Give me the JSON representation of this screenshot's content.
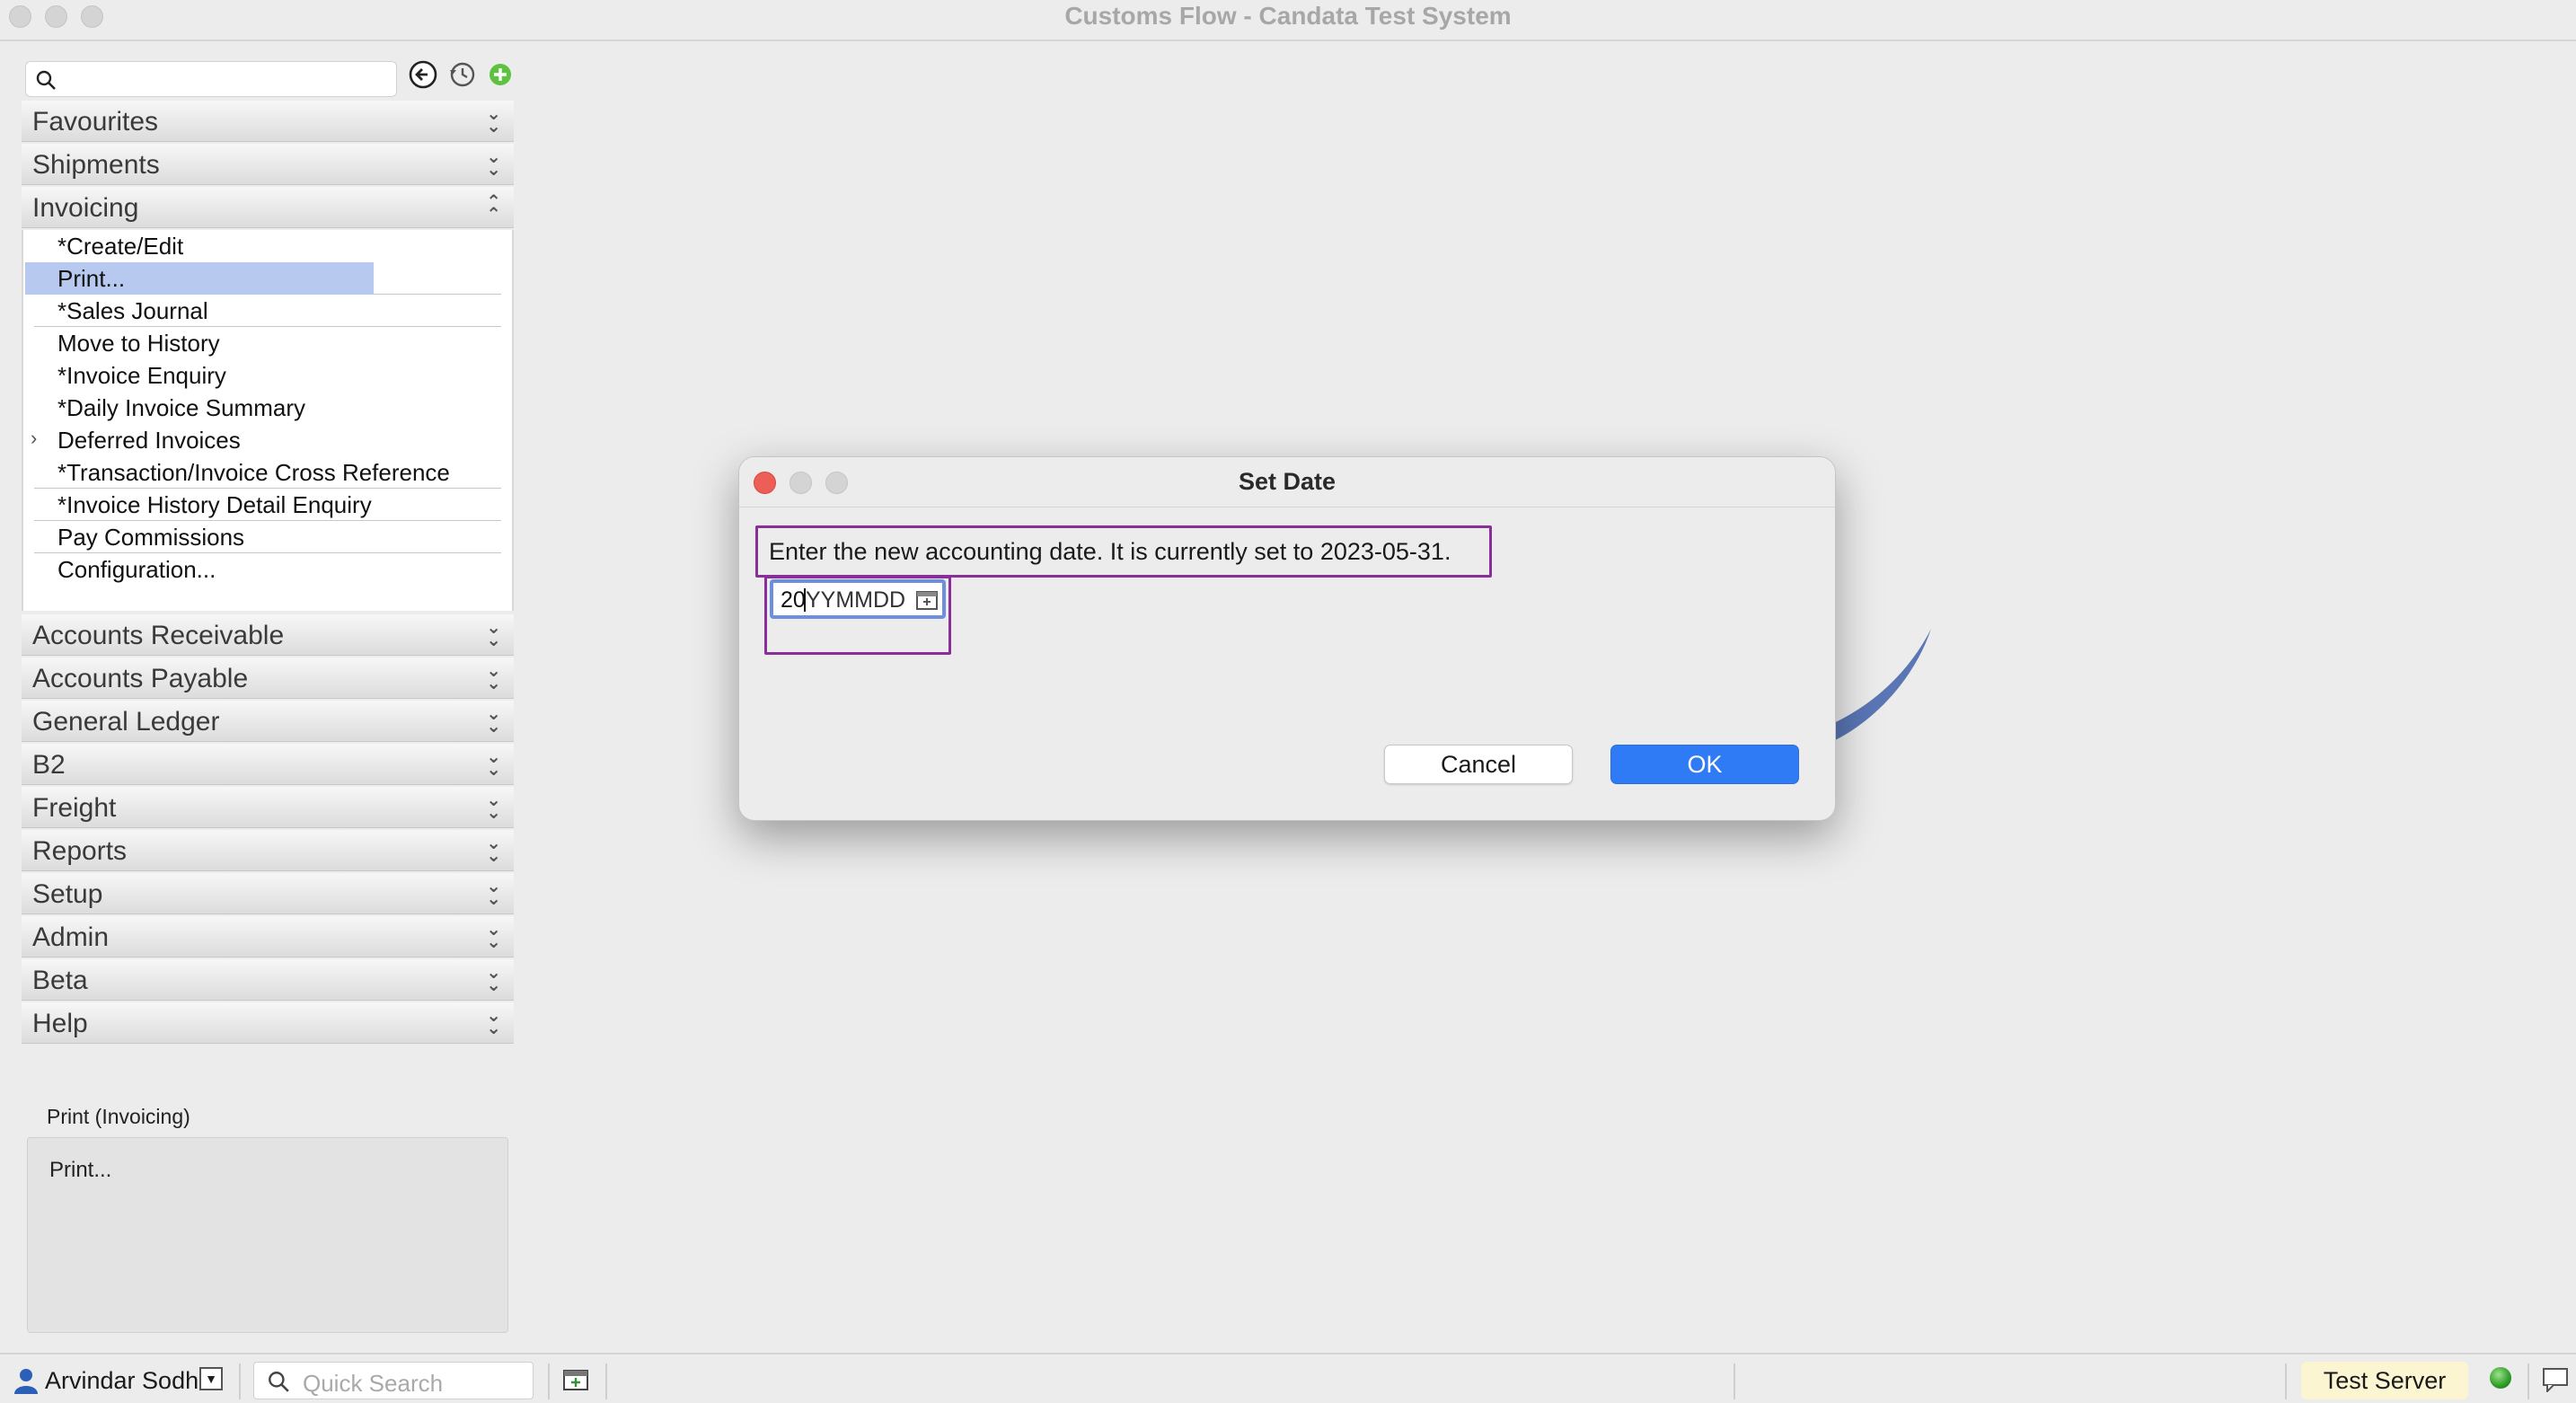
{
  "window": {
    "title": "Customs Flow - Candata Test System"
  },
  "sidebar": {
    "search_placeholder": "",
    "sections_top": [
      {
        "label": "Favourites",
        "chevron": "»"
      },
      {
        "label": "Shipments",
        "chevron": "»"
      },
      {
        "label": "Invoicing",
        "chevron": "«"
      }
    ],
    "invoicing_items": [
      {
        "label": "*Create/Edit"
      },
      {
        "label": "Print..."
      },
      {
        "label": "*Sales Journal"
      },
      {
        "label": "Move to History"
      },
      {
        "label": "*Invoice Enquiry"
      },
      {
        "label": "*Daily Invoice Summary"
      },
      {
        "label": "Deferred Invoices",
        "expand_arrow": "›"
      },
      {
        "label": "*Transaction/Invoice Cross Reference"
      },
      {
        "label": "*Invoice History Detail Enquiry"
      },
      {
        "label": "Pay Commissions"
      },
      {
        "label": "Configuration..."
      }
    ],
    "sections_bottom": [
      {
        "label": "Accounts Receivable",
        "chevron": "»"
      },
      {
        "label": "Accounts Payable",
        "chevron": "»"
      },
      {
        "label": "General Ledger",
        "chevron": "»"
      },
      {
        "label": "B2",
        "chevron": "»"
      },
      {
        "label": "Freight",
        "chevron": "»"
      },
      {
        "label": "Reports",
        "chevron": "»"
      },
      {
        "label": "Setup",
        "chevron": "»"
      },
      {
        "label": "Admin",
        "chevron": "»"
      },
      {
        "label": "Beta",
        "chevron": "»"
      },
      {
        "label": "Help",
        "chevron": "»"
      }
    ],
    "info": {
      "title": "Print (Invoicing)",
      "body": "Print..."
    }
  },
  "dialog": {
    "title": "Set Date",
    "message": "Enter the new accounting date. It is currently set to 2023-05-31.",
    "date_value": "20",
    "date_placeholder": "YYMMDD",
    "cancel_label": "Cancel",
    "ok_label": "OK"
  },
  "statusbar": {
    "user": "Arvindar Sodhi",
    "user_dropdown": "▼",
    "quick_search_placeholder": "Quick Search",
    "server": "Test Server"
  },
  "colors": {
    "accent": "#2f7bf5",
    "selection": "#b7c9ee",
    "highlight_box": "#8a2e9a",
    "server_badge": "#fbf5d2",
    "status_ok": "#2f9a2a"
  },
  "icons": [
    "search-icon",
    "back-icon",
    "history-icon",
    "add-icon",
    "calendar-icon",
    "user-icon",
    "calendar-status-icon",
    "status-light-icon",
    "chat-icon"
  ]
}
